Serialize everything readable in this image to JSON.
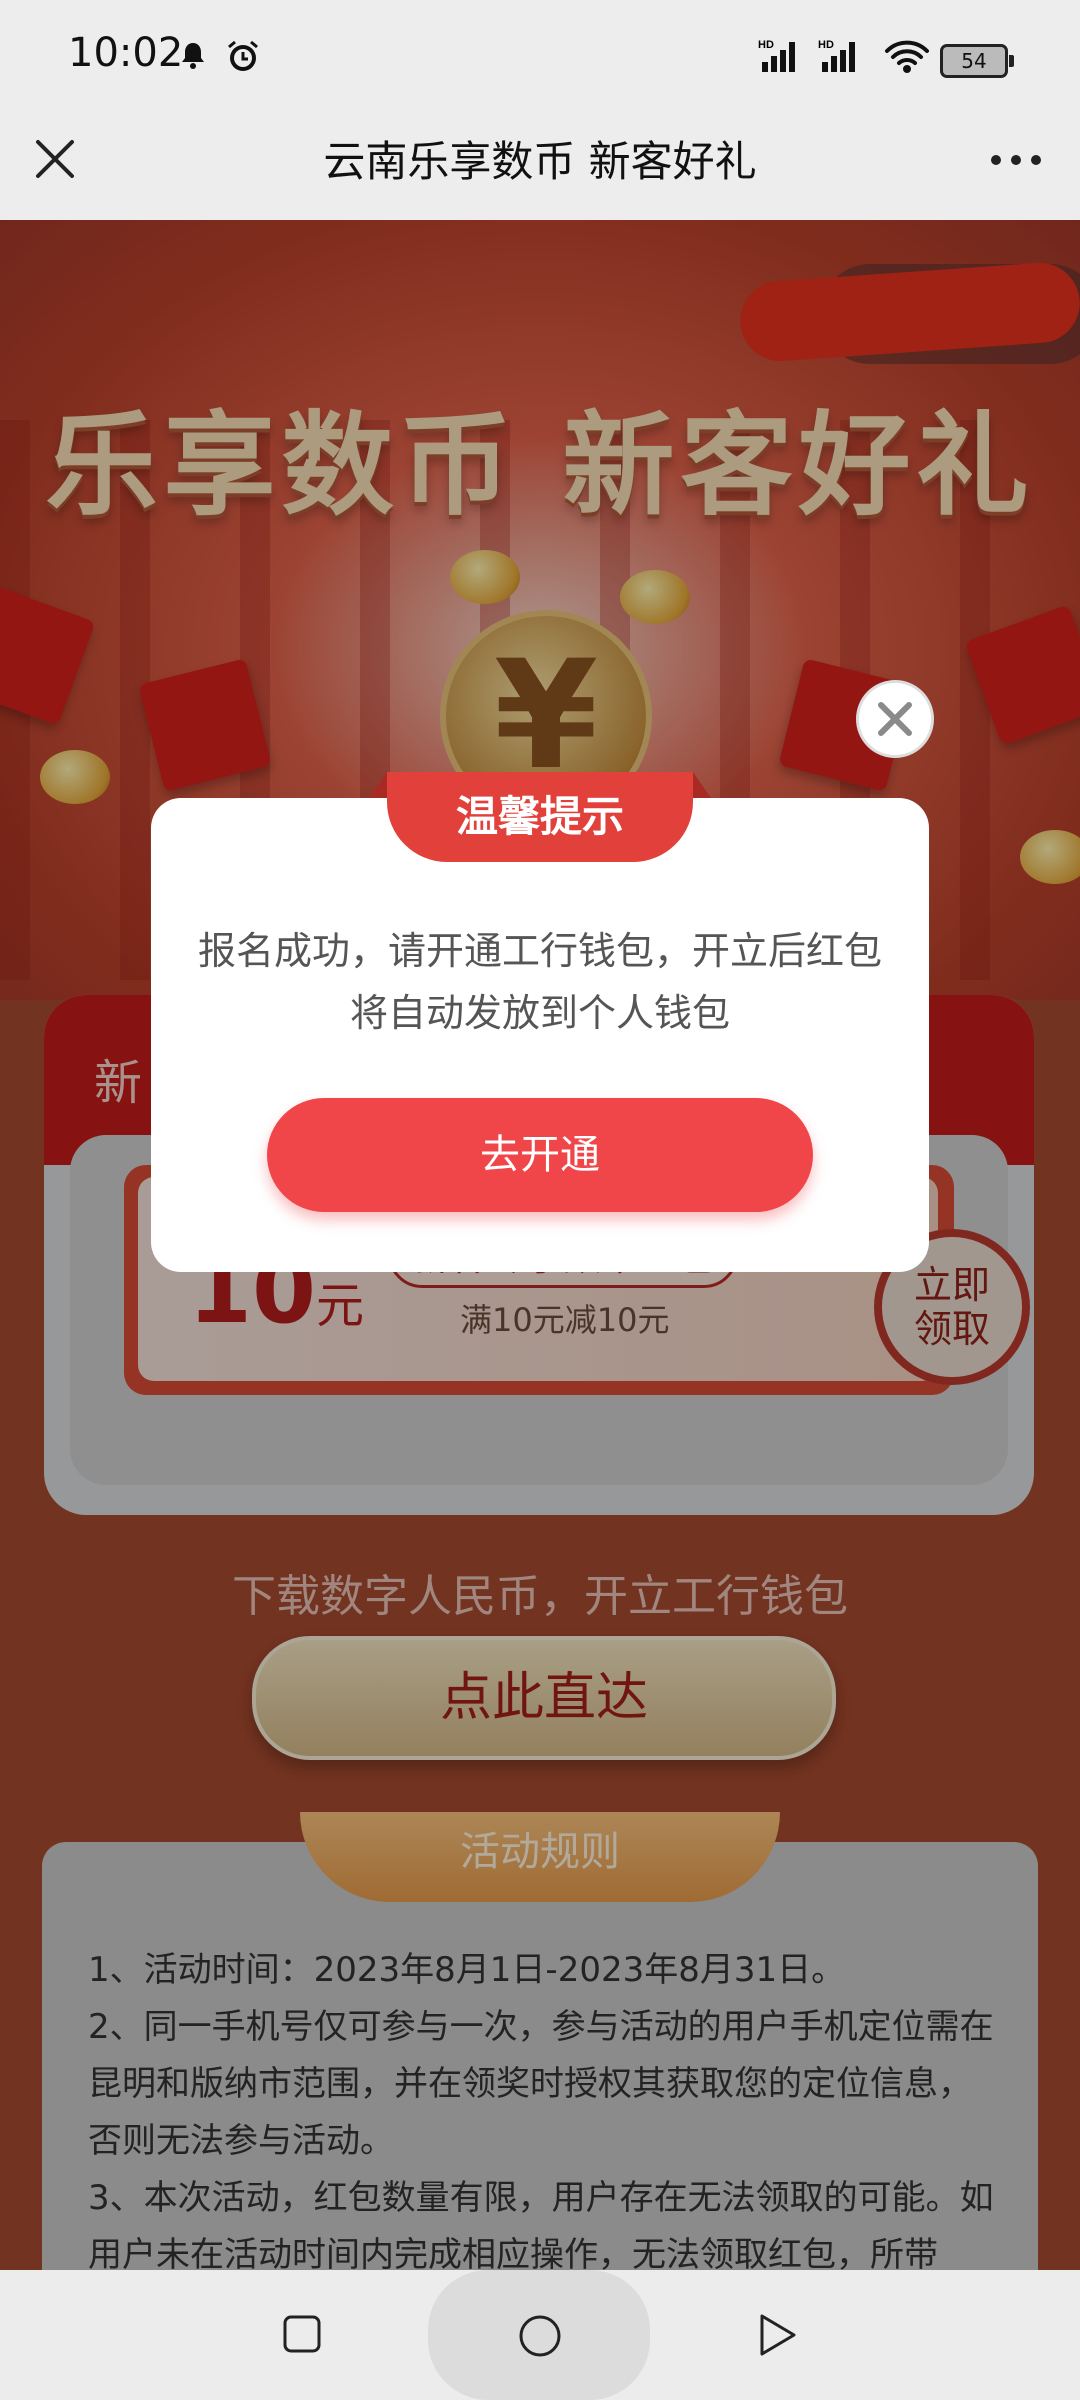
{
  "status_bar": {
    "time": "10:02",
    "signal1_label": "HD",
    "signal2_label": "HD",
    "battery": "54"
  },
  "title_bar": {
    "title": "云南乐享数币 新客好礼"
  },
  "hero": {
    "title": "乐享数币 新客好礼",
    "coin_symbol": "¥"
  },
  "card": {
    "header": "新",
    "coupon": {
      "amount": "10",
      "unit": "元",
      "name": "新客专享数币红包",
      "condition": "满10元减10元",
      "claim_label": "立即领取"
    }
  },
  "download": {
    "text": "下载数字人民币，开立工行钱包",
    "button": "点此直达"
  },
  "rules": {
    "tab": "活动规则",
    "items": [
      "1、活动时间：2023年8月1日-2023年8月31日。",
      "2、同一手机号仅可参与一次，参与活动的用户手机定位需在昆明和版纳市范围，并在领奖时授权其获取您的定位信息，否则无法参与活动。",
      "3、本次活动，红包数量有限，用户存在无法领取的可能。如用户未在活动时间内完成相应操作，无法领取红包，所带"
    ]
  },
  "dialog": {
    "title": "温馨提示",
    "message": "报名成功，请开通工行钱包，开立后红包将自动发放到个人钱包",
    "button": "去开通"
  },
  "colors": {
    "accent_red": "#f0464a",
    "hero_red": "#c01b1b",
    "gold": "#d4b887"
  }
}
